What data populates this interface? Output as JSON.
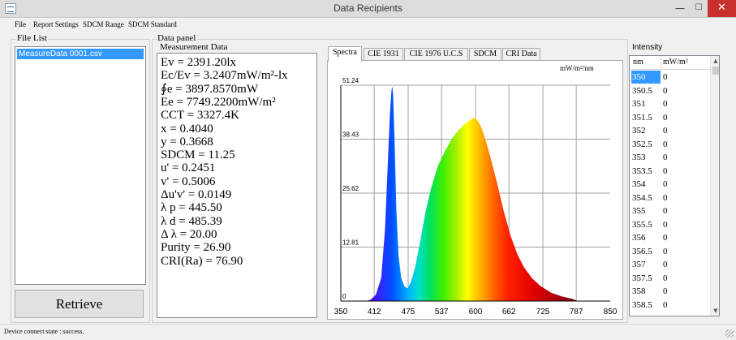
{
  "window": {
    "title": "Data Recipients",
    "minimize": "—",
    "maximize": "☐",
    "close": "✕"
  },
  "menu": {
    "items": [
      "File",
      "Report Settings",
      "SDCM Range",
      "SDCM Standard"
    ]
  },
  "file_list": {
    "label": "File List",
    "files": [
      "MeasureData 0001.csv"
    ]
  },
  "retrieve_label": "Retrieve",
  "data_panel": {
    "label": "Data panel",
    "measurement_label": "Measurement Data",
    "lines": [
      "Ev = 2391.20lx",
      "Ec/Ev = 3.2407mW/m²-lx",
      " ∮e = 3897.8570mW",
      "Ee = 7749.2200mW/m²",
      "CCT = 3327.4K",
      "x = 0.4040",
      "y = 0.3668",
      "SDCM = 11.25",
      "u' = 0.2451",
      "v' = 0.5006",
      "Δu'v' = 0.0149",
      " λ p = 445.50",
      " λ d = 485.39",
      "Δ λ  = 20.00",
      "Purity = 26.90",
      "CRI(Ra) = 76.90"
    ]
  },
  "tabs": [
    {
      "label": "Spectra",
      "active": true
    },
    {
      "label": "CIE 1931",
      "active": false
    },
    {
      "label": "CIE 1976 U.C.S",
      "active": false
    },
    {
      "label": "SDCM",
      "active": false
    },
    {
      "label": "CRI Data",
      "active": false
    }
  ],
  "chart_data": {
    "type": "area",
    "ylabel": "mW/m²/nm",
    "xlim": [
      350,
      850
    ],
    "ylim": [
      0,
      51.24
    ],
    "x_ticks": [
      "350",
      "412",
      "475",
      "537",
      "600",
      "662",
      "725",
      "787",
      "850"
    ],
    "y_ticks": [
      "0",
      "12.81",
      "25.62",
      "38.43",
      "51.24"
    ],
    "grid": true,
    "x": [
      380,
      395,
      405,
      415,
      425,
      432,
      437,
      441,
      444,
      445.5,
      447,
      450,
      453,
      457,
      462,
      468,
      474,
      480,
      488,
      497,
      507,
      518,
      530,
      543,
      556,
      568,
      580,
      590,
      597,
      603,
      610,
      618,
      628,
      640,
      652,
      665,
      678,
      690,
      705,
      720,
      740,
      760,
      780,
      790
    ],
    "values": [
      0,
      0,
      0.3,
      1.5,
      5.5,
      17,
      32,
      44,
      50,
      51,
      49,
      37,
      22,
      11,
      5.5,
      3.5,
      3.0,
      4.5,
      8,
      14,
      21,
      27,
      32,
      35.5,
      38.5,
      40.5,
      42,
      43,
      43.5,
      43,
      41.5,
      38.5,
      34,
      28,
      21.5,
      15.5,
      11,
      8,
      5.4,
      3.6,
      2,
      1.1,
      0.5,
      0
    ]
  },
  "intensity": {
    "label": "Intensity",
    "columns": [
      "nm",
      "mW/m²"
    ],
    "rows": [
      [
        "350",
        "0"
      ],
      [
        "350.5",
        "0"
      ],
      [
        "351",
        "0"
      ],
      [
        "351.5",
        "0"
      ],
      [
        "352",
        "0"
      ],
      [
        "352.5",
        "0"
      ],
      [
        "353",
        "0"
      ],
      [
        "353.5",
        "0"
      ],
      [
        "354",
        "0"
      ],
      [
        "354.5",
        "0"
      ],
      [
        "355",
        "0"
      ],
      [
        "355.5",
        "0"
      ],
      [
        "356",
        "0"
      ],
      [
        "356.5",
        "0"
      ],
      [
        "357",
        "0"
      ],
      [
        "357.5",
        "0"
      ],
      [
        "358",
        "0"
      ],
      [
        "358.5",
        "0"
      ]
    ],
    "scroll_up": "▲",
    "scroll_down": "▼"
  },
  "status": {
    "text": "Device connect state : success."
  }
}
